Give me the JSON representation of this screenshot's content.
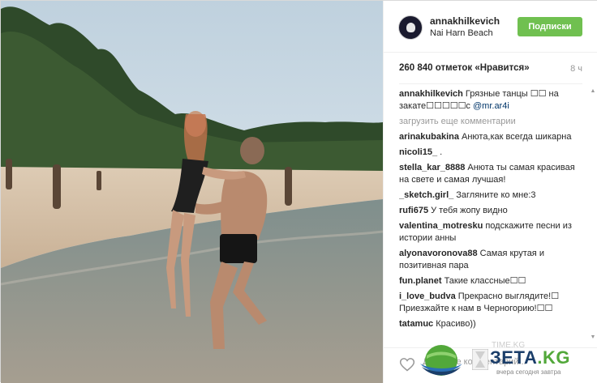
{
  "post": {
    "username": "annakhilkevich",
    "location": "Nai Harn Beach",
    "follow_label": "Подписки",
    "likes_text": "260 840 отметок «Нравится»",
    "time": "8 ч",
    "caption_user": "annakhilkevich",
    "caption_text": "Грязные танцы ☐☐ на закате☐☐☐☐☐с",
    "caption_mention": "@mr.ar4i",
    "load_more": "загрузить еще комментарии",
    "comment_placeholder": "Добавьте комментарий..."
  },
  "comments": [
    {
      "user": "arinakubakina",
      "text": "Анюта,как всегда шикарна"
    },
    {
      "user": "nicoli15_",
      "text": "."
    },
    {
      "user": "stella_kar_8888",
      "text": "Анюта ты самая красивая на свете и самая лучшая!"
    },
    {
      "user": "_sketch.girl_",
      "text": "Загляните ко мне:3"
    },
    {
      "user": "rufi675",
      "text": "У тебя жопу видно"
    },
    {
      "user": "valentina_motresku",
      "text": "подскажите песни из истории анны"
    },
    {
      "user": "alyonavoronova88",
      "text": "Самая крутая и позитивная пара"
    },
    {
      "user": "fun.planet",
      "text": "Такие классные☐☐"
    },
    {
      "user": "i_love_budva",
      "text": "Прекрасно выглядите!☐ Приезжайте к нам в Черногорию!☐☐"
    },
    {
      "user": "tatamuc",
      "text": "Красиво))"
    }
  ],
  "watermark": {
    "logo_main": "ЗЕТА",
    "logo_suffix": ".KG",
    "tagline": "вчера сегодня завтра",
    "faint_text": "TIME.KG"
  },
  "colors": {
    "follow_button": "#70c050",
    "mention": "#003569",
    "logo_blue": "#1b3e6a",
    "logo_green": "#52a83a"
  },
  "icons": {
    "like": "heart-icon",
    "avatar": "avatar-logo"
  }
}
